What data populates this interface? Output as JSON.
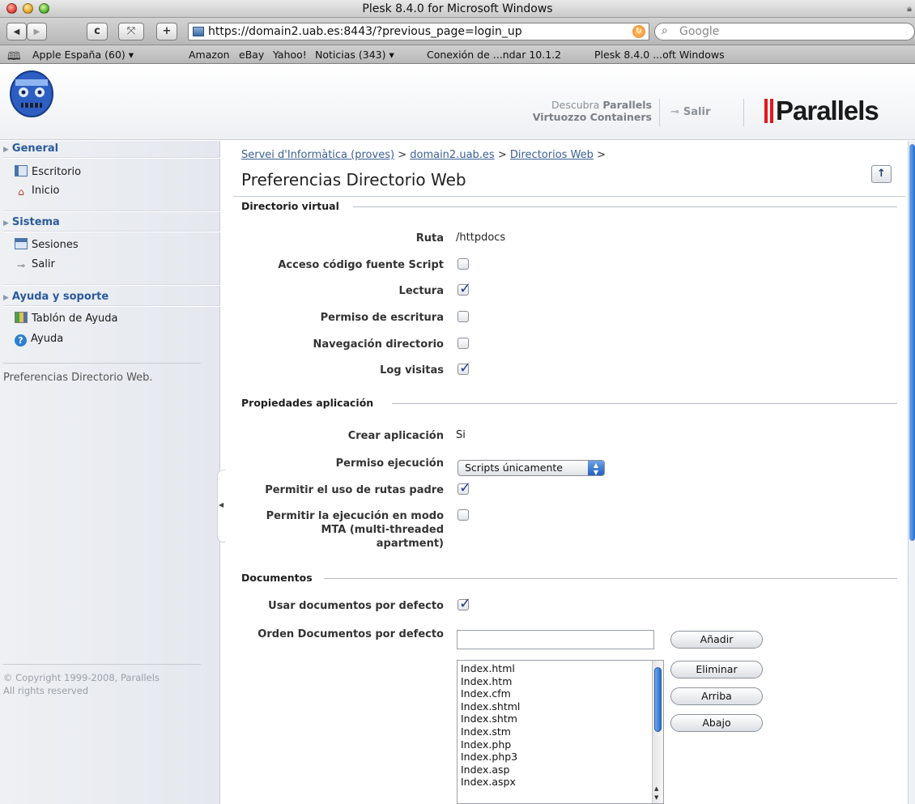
{
  "browser": {
    "window_title": "Plesk 8.4.0 for Microsoft Windows",
    "url": "https://domain2.uab.es:8443/?previous_page=login_up",
    "search_placeholder": "Google",
    "toolbar": {
      "back": "◀",
      "forward": "▶",
      "reload": "c",
      "snapback": "⤧",
      "add": "+"
    },
    "bookmarks": [
      "Apple España (60)",
      "Amazon",
      "eBay",
      "Yahoo!",
      "Noticias (343)",
      "Conexión de ...ndar 10.1.2",
      "Plesk 8.4.0 ...oft Windows"
    ]
  },
  "header": {
    "promo_line1": "Descubra",
    "promo_line1_bold": "Parallels",
    "promo_line2": "Virtuozzo Containers",
    "logout_label": "Salir",
    "brand_name": "Parallels",
    "brand_color": "#e0191e",
    "logout_icon": "exit-icon"
  },
  "sidebar": {
    "sections": [
      {
        "title": "General",
        "items": [
          {
            "label": "Escritorio",
            "icon": "desktop-icon"
          },
          {
            "label": "Inicio",
            "icon": "home-icon"
          }
        ]
      },
      {
        "title": "Sistema",
        "items": [
          {
            "label": "Sesiones",
            "icon": "sessions-icon"
          },
          {
            "label": "Salir",
            "icon": "exit-icon"
          }
        ]
      },
      {
        "title": "Ayuda y soporte",
        "items": [
          {
            "label": "Tablón de Ayuda",
            "icon": "help-board-icon"
          },
          {
            "label": "Ayuda",
            "icon": "help-icon"
          }
        ]
      }
    ],
    "description": "Preferencias Directorio Web.",
    "copyright_line1": "© Copyright 1999-2008, Parallels",
    "copyright_line2": "All rights reserved"
  },
  "main": {
    "breadcrumb": [
      {
        "label": "Servei d'Informàtica (proves)",
        "link": true
      },
      {
        "label": "domain2.uab.es",
        "link": true
      },
      {
        "label": "Directorios Web",
        "link": true
      }
    ],
    "breadcrumb_sep": ">",
    "page_title": "Preferencias Directorio Web",
    "up_button": "↑",
    "virtual_dir": {
      "heading": "Directorio virtual",
      "ruta_label": "Ruta",
      "ruta_value": "/httpdocs",
      "fields": [
        {
          "label": "Acceso código fuente Script",
          "checked": false
        },
        {
          "label": "Lectura",
          "checked": true
        },
        {
          "label": "Permiso de escritura",
          "checked": false
        },
        {
          "label": "Navegación directorio",
          "checked": false
        },
        {
          "label": "Log visitas",
          "checked": true
        }
      ]
    },
    "app_props": {
      "heading": "Propiedades aplicación",
      "crear_label": "Crear aplicación",
      "crear_value": "Si",
      "permiso_label": "Permiso ejecución",
      "permiso_value": "Scripts únicamente",
      "rutas_padre_label": "Permitir el uso de rutas padre",
      "rutas_padre_checked": true,
      "mta_label_line1": "Permitir la ejecución en modo",
      "mta_label_line2": "MTA (multi-threaded",
      "mta_label_line3": "apartment)",
      "mta_checked": false
    },
    "documents": {
      "heading": "Documentos",
      "usar_label": "Usar documentos por defecto",
      "usar_checked": true,
      "orden_label": "Orden Documentos por defecto",
      "orden_value": "",
      "buttons": {
        "add": "Añadir",
        "remove": "Eliminar",
        "up": "Arriba",
        "down": "Abajo"
      },
      "list": [
        "Index.html",
        "Index.htm",
        "Index.cfm",
        "Index.shtml",
        "Index.shtm",
        "Index.stm",
        "Index.php",
        "Index.php3",
        "Index.asp",
        "Index.aspx"
      ]
    }
  }
}
